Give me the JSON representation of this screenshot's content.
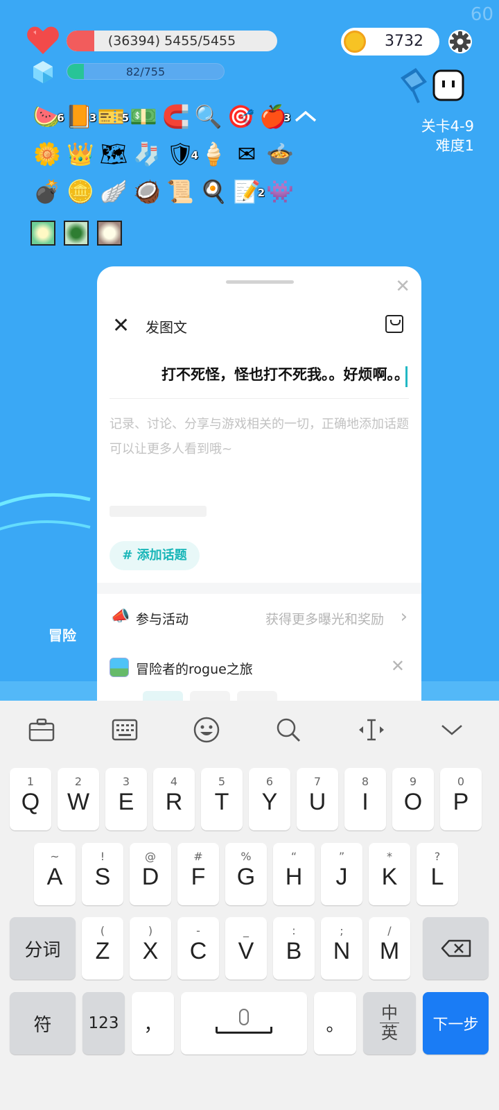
{
  "game": {
    "fps": "60",
    "hp_text": "(36394) 5455/5455",
    "hp_fraction": 0.13,
    "xp_text": "82/755",
    "xp_fraction": 0.108,
    "coins": "3732",
    "stage": "关卡4-9",
    "difficulty": "难度1",
    "arena_sign": "冒险",
    "items_row1": [
      {
        "glyph": "🍉",
        "count": "6"
      },
      {
        "glyph": "📙",
        "count": "3"
      },
      {
        "glyph": "🎫",
        "count": "5"
      },
      {
        "glyph": "💵",
        "count": ""
      },
      {
        "glyph": "🧲",
        "count": ""
      },
      {
        "glyph": "🔍",
        "count": ""
      },
      {
        "glyph": "🎯",
        "count": ""
      },
      {
        "glyph": "🍎",
        "count": "3"
      }
    ],
    "items_row2": [
      {
        "glyph": "🌼",
        "count": ""
      },
      {
        "glyph": "👑",
        "count": ""
      },
      {
        "glyph": "🗺",
        "count": ""
      },
      {
        "glyph": "🧦",
        "count": ""
      },
      {
        "glyph": "🛡",
        "count": "4"
      },
      {
        "glyph": "🍦",
        "count": ""
      },
      {
        "glyph": "✉",
        "count": ""
      },
      {
        "glyph": "🍲",
        "count": ""
      }
    ],
    "items_row3": [
      {
        "glyph": "💣",
        "count": ""
      },
      {
        "glyph": "🪙",
        "count": ""
      },
      {
        "glyph": "🪽",
        "count": ""
      },
      {
        "glyph": "🥥",
        "count": ""
      },
      {
        "glyph": "📜",
        "count": ""
      },
      {
        "glyph": "🍳",
        "count": ""
      },
      {
        "glyph": "📝",
        "count": "2"
      },
      {
        "glyph": "👾",
        "count": ""
      }
    ],
    "collapse_icon": "chevron-up-icon",
    "colors": {
      "sky": "#3aa8f5",
      "hp": "#f25c5c",
      "xp": "#28c497",
      "coin": "#f7c324"
    }
  },
  "sheet": {
    "title": "发图文",
    "title_input_value": "打不死怪，怪也打不死我。。好烦啊。。",
    "body_placeholder": "记录、讨论、分享与游戏相关的一切，正确地添加话题可以让更多人看到哦~",
    "add_topic": "# 添加话题",
    "activity_label": "参与活动",
    "activity_hint": "获得更多曝光和奖励",
    "game_name": "冒险者的rogue之旅",
    "accent": "#19b6b8"
  },
  "keyboard": {
    "row1": [
      {
        "sub": "1",
        "main": "Q"
      },
      {
        "sub": "2",
        "main": "W"
      },
      {
        "sub": "3",
        "main": "E"
      },
      {
        "sub": "4",
        "main": "R"
      },
      {
        "sub": "5",
        "main": "T"
      },
      {
        "sub": "6",
        "main": "Y"
      },
      {
        "sub": "7",
        "main": "U"
      },
      {
        "sub": "8",
        "main": "I"
      },
      {
        "sub": "9",
        "main": "O"
      },
      {
        "sub": "0",
        "main": "P"
      }
    ],
    "row2": [
      {
        "sub": "~",
        "main": "A"
      },
      {
        "sub": "!",
        "main": "S"
      },
      {
        "sub": "@",
        "main": "D"
      },
      {
        "sub": "#",
        "main": "F"
      },
      {
        "sub": "%",
        "main": "G"
      },
      {
        "sub": "“",
        "main": "H"
      },
      {
        "sub": "”",
        "main": "J"
      },
      {
        "sub": "*",
        "main": "K"
      },
      {
        "sub": "?",
        "main": "L"
      }
    ],
    "row3": [
      {
        "sub": "(",
        "main": "Z"
      },
      {
        "sub": ")",
        "main": "X"
      },
      {
        "sub": "-",
        "main": "C"
      },
      {
        "sub": "_",
        "main": "V"
      },
      {
        "sub": ":",
        "main": "B"
      },
      {
        "sub": ";",
        "main": "N"
      },
      {
        "sub": "/",
        "main": "M"
      }
    ],
    "fenci": "分词",
    "symbols": "符",
    "numbers": "123",
    "comma": "，",
    "period": "。",
    "lang_top": "中",
    "lang_bottom": "英",
    "next": "下一步"
  }
}
